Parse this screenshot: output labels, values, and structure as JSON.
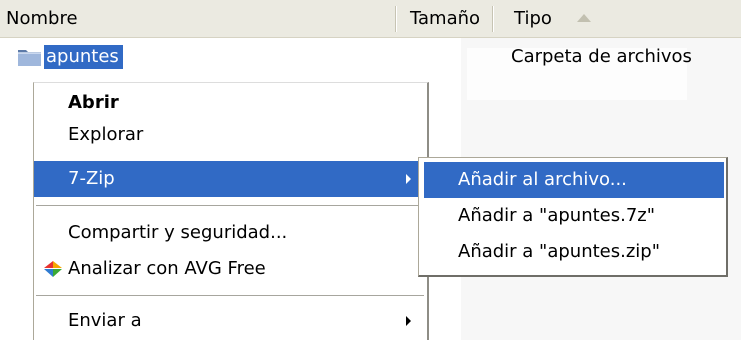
{
  "header": {
    "col_name": "Nombre",
    "col_size": "Tamaño",
    "col_type": "Tipo"
  },
  "file": {
    "name": "apuntes",
    "type": "Carpeta de archivos",
    "icon": "folder-icon"
  },
  "context_menu": {
    "items": [
      {
        "label": "Abrir",
        "bold": true
      },
      {
        "label": "Explorar"
      },
      {
        "label": "7-Zip",
        "submenu": true,
        "selected": true
      },
      {
        "label": "Compartir y seguridad..."
      },
      {
        "label": "Analizar con AVG Free",
        "icon": "avg-icon"
      },
      {
        "label": "Enviar a",
        "submenu": true
      }
    ]
  },
  "submenu": {
    "items": [
      {
        "label": "Añadir al archivo...",
        "selected": true
      },
      {
        "label": "Añadir a \"apuntes.7z\""
      },
      {
        "label": "Añadir a \"apuntes.zip\""
      }
    ]
  },
  "colors": {
    "selection": "#316ac5",
    "header_bg": "#ebeae1"
  }
}
